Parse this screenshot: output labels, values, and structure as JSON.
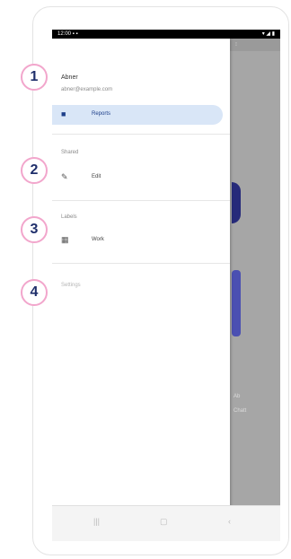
{
  "status_bar": {
    "time": "12:00 ▪ ▪",
    "icons": "▾ ◢ ▮"
  },
  "backdrop": {
    "top_text": "⁝",
    "side_lines": [
      "Ab",
      "Chatt"
    ]
  },
  "drawer": {
    "account": {
      "name": "Abner",
      "email": "abner@example.com"
    },
    "primary_item": {
      "icon": "folder-icon",
      "label": "Reports"
    },
    "section2": {
      "title": "Shared",
      "item": {
        "icon": "pencil-icon",
        "label": "Edit"
      }
    },
    "section3": {
      "title": "Labels",
      "item": {
        "icon": "grid-icon",
        "label": "Work"
      }
    },
    "section4": {
      "title": "Settings"
    }
  },
  "badges": [
    "1",
    "2",
    "3",
    "4"
  ],
  "colors": {
    "badge_border": "#f2a6cc",
    "badge_text": "#1f2f6b",
    "active_item_bg": "#d9e6f7",
    "scrim": "#a6a6a6",
    "accent_pill": "#3b3f9a"
  }
}
